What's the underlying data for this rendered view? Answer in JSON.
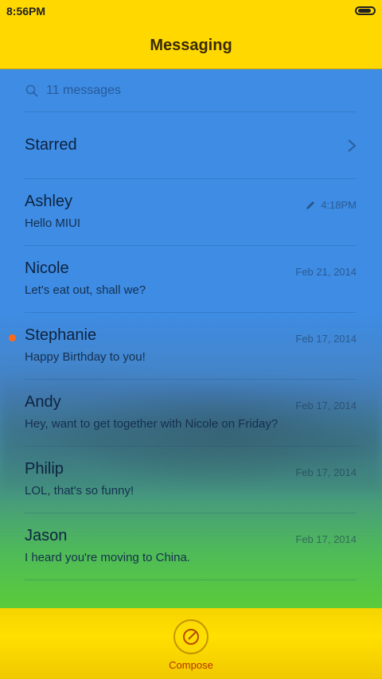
{
  "status": {
    "time": "8:56PM"
  },
  "app": {
    "title": "Messaging"
  },
  "search": {
    "placeholder": "11 messages"
  },
  "starred": {
    "label": "Starred"
  },
  "conversations": [
    {
      "name": "Ashley",
      "preview": "Hello MIUI",
      "date": "4:18PM",
      "draft": true,
      "unread": false
    },
    {
      "name": "Nicole",
      "preview": "Let's eat out, shall we?",
      "date": "Feb 21, 2014",
      "draft": false,
      "unread": false
    },
    {
      "name": "Stephanie",
      "preview": "Happy Birthday to you!",
      "date": "Feb 17, 2014",
      "draft": false,
      "unread": true
    },
    {
      "name": "Andy",
      "preview": "Hey, want to get together with Nicole on Friday?",
      "date": "Feb 17, 2014",
      "draft": false,
      "unread": false
    },
    {
      "name": "Philip",
      "preview": "LOL, that's so funny!",
      "date": "Feb 17, 2014",
      "draft": false,
      "unread": false
    },
    {
      "name": "Jason",
      "preview": "I heard you're moving to China.",
      "date": "Feb 17, 2014",
      "draft": false,
      "unread": false
    }
  ],
  "compose": {
    "label": "Compose"
  },
  "colors": {
    "bar": "#ffd800",
    "unread": "#ff6a1a",
    "compose": "#b83200"
  }
}
